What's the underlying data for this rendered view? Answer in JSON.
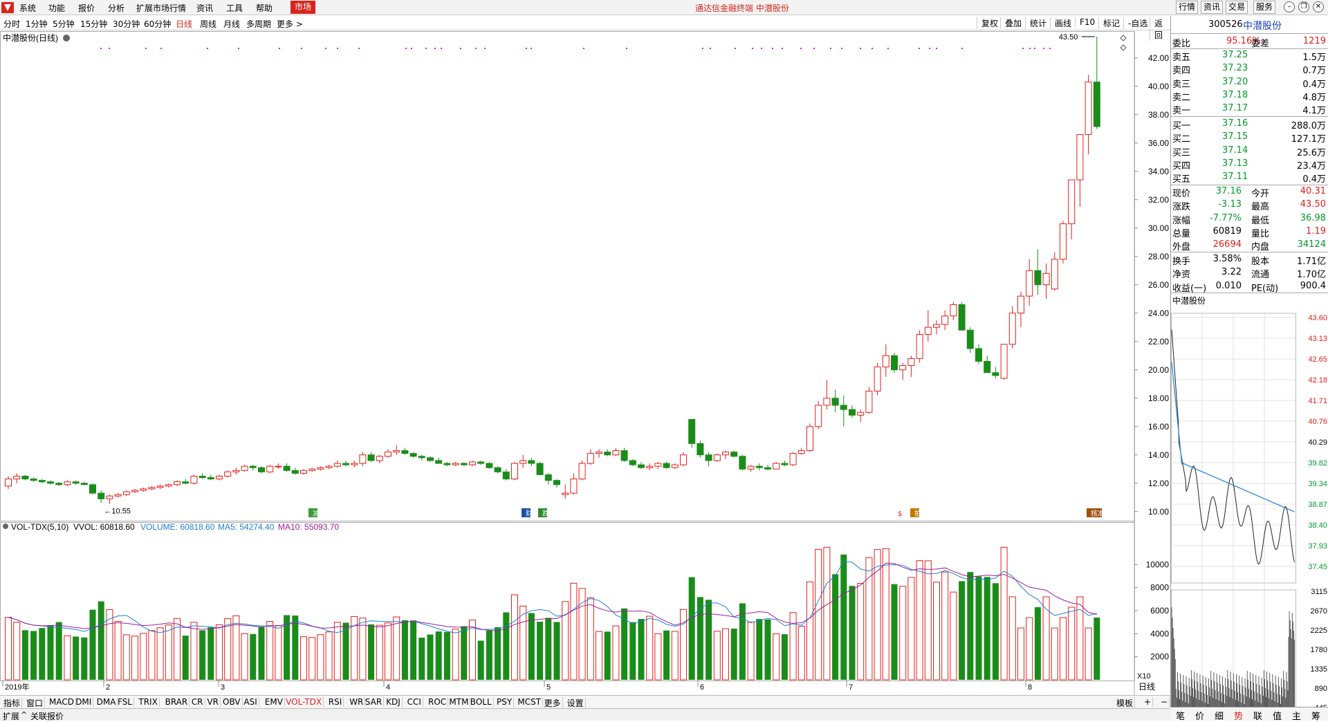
{
  "menu": {
    "items": [
      "系统",
      "功能",
      "报价",
      "分析",
      "扩展市场行情",
      "资讯",
      "工具",
      "帮助"
    ],
    "active": "市场",
    "title": "通达信金融终端  中潜股份",
    "right_buttons": [
      "行情",
      "资讯",
      "交易",
      "服务"
    ]
  },
  "periodbar": {
    "periods": [
      "分时",
      "1分钟",
      "5分钟",
      "15分钟",
      "30分钟",
      "60分钟",
      "日线",
      "周线",
      "月线",
      "多周期",
      "更多 >"
    ],
    "selected": "日线",
    "tools": [
      "复权",
      "叠加",
      "统计",
      "画线",
      "F10",
      "标记",
      "-自选",
      "返回"
    ]
  },
  "chart": {
    "title": "中潜股份(日线)",
    "high_label": "43.50",
    "low_label": "10.55",
    "price_ticks": [
      "42.00",
      "40.00",
      "38.00",
      "36.00",
      "34.00",
      "32.00",
      "30.00",
      "28.00",
      "26.00",
      "24.00",
      "22.00",
      "20.00",
      "18.00",
      "16.00",
      "14.00",
      "12.00",
      "10.00"
    ],
    "markers": [
      "减",
      "财",
      "跌",
      "$",
      "拍",
      "核准"
    ],
    "vol_legend": {
      "name": "VOL-TDX(5,10)",
      "vvol": "VVOL: 60818.60",
      "volume": "VOLUME: 60818.60",
      "ma5": "MA5: 54274.40",
      "ma10": "MA10: 55093.70"
    },
    "vol_ticks": [
      "10000",
      "8000",
      "6000",
      "4000",
      "2000"
    ],
    "vol_unit": "X10",
    "date_labels": [
      "2019年",
      "2",
      "3",
      "4",
      "5",
      "6",
      "7",
      "8"
    ],
    "colors": {
      "up": "#e0201b",
      "down": "#1a8c1a",
      "ma5": "#1e7fd6",
      "ma10": "#9b1f9b"
    }
  },
  "chart_data": {
    "type": "candlestick",
    "title": "中潜股份(日线)",
    "ylim": [
      9.5,
      43.5
    ],
    "candles": [
      [
        11.8,
        12.5,
        11.6,
        12.3
      ],
      [
        12.3,
        12.7,
        12.0,
        12.5
      ],
      [
        12.5,
        12.6,
        12.2,
        12.3
      ],
      [
        12.3,
        12.4,
        12.1,
        12.2
      ],
      [
        12.2,
        12.3,
        12.0,
        12.1
      ],
      [
        12.1,
        12.2,
        11.9,
        12.0
      ],
      [
        12.0,
        12.1,
        11.8,
        11.9
      ],
      [
        11.9,
        12.2,
        11.8,
        12.1
      ],
      [
        12.1,
        12.2,
        11.9,
        12.0
      ],
      [
        12.0,
        12.1,
        11.9,
        11.9
      ],
      [
        11.9,
        12.0,
        11.2,
        11.3
      ],
      [
        11.3,
        11.5,
        10.6,
        10.9
      ],
      [
        10.9,
        11.2,
        10.55,
        11.1
      ],
      [
        11.1,
        11.3,
        11.0,
        11.2
      ],
      [
        11.2,
        11.5,
        11.1,
        11.4
      ],
      [
        11.4,
        11.6,
        11.3,
        11.5
      ],
      [
        11.5,
        11.7,
        11.4,
        11.6
      ],
      [
        11.6,
        11.8,
        11.5,
        11.7
      ],
      [
        11.7,
        11.9,
        11.6,
        11.8
      ],
      [
        11.8,
        12.0,
        11.7,
        11.9
      ],
      [
        11.9,
        12.2,
        11.8,
        12.1
      ],
      [
        12.1,
        12.3,
        11.9,
        12.0
      ],
      [
        12.0,
        12.6,
        11.9,
        12.5
      ],
      [
        12.5,
        12.7,
        12.3,
        12.4
      ],
      [
        12.4,
        12.6,
        12.2,
        12.3
      ],
      [
        12.3,
        12.6,
        12.2,
        12.5
      ],
      [
        12.5,
        12.9,
        12.4,
        12.8
      ],
      [
        12.8,
        13.1,
        12.6,
        12.9
      ],
      [
        12.9,
        13.3,
        12.8,
        13.2
      ],
      [
        13.2,
        13.3,
        12.9,
        13.1
      ],
      [
        13.1,
        13.2,
        12.7,
        12.8
      ],
      [
        12.8,
        13.3,
        12.7,
        13.2
      ],
      [
        13.2,
        13.4,
        13.0,
        13.2
      ],
      [
        13.2,
        13.4,
        12.8,
        12.9
      ],
      [
        12.9,
        13.1,
        12.6,
        12.7
      ],
      [
        12.7,
        13.0,
        12.6,
        12.9
      ],
      [
        12.9,
        13.1,
        12.8,
        13.0
      ],
      [
        13.0,
        13.2,
        12.9,
        13.1
      ],
      [
        13.1,
        13.3,
        13.0,
        13.2
      ],
      [
        13.2,
        13.6,
        13.1,
        13.4
      ],
      [
        13.4,
        13.6,
        13.2,
        13.3
      ],
      [
        13.3,
        13.6,
        13.1,
        13.4
      ],
      [
        13.4,
        14.2,
        13.2,
        14.0
      ],
      [
        14.0,
        14.2,
        13.5,
        13.6
      ],
      [
        13.6,
        14.0,
        13.4,
        13.9
      ],
      [
        13.9,
        14.4,
        13.8,
        14.2
      ],
      [
        14.2,
        14.7,
        14.0,
        14.3
      ],
      [
        14.3,
        14.5,
        14.0,
        14.1
      ],
      [
        14.1,
        14.2,
        13.8,
        13.9
      ],
      [
        13.9,
        14.0,
        13.6,
        13.8
      ],
      [
        13.8,
        13.9,
        13.5,
        13.6
      ],
      [
        13.6,
        13.8,
        13.4,
        13.4
      ],
      [
        13.4,
        13.5,
        13.2,
        13.3
      ],
      [
        13.3,
        13.5,
        13.2,
        13.4
      ],
      [
        13.4,
        13.5,
        13.2,
        13.3
      ],
      [
        13.3,
        13.6,
        13.2,
        13.5
      ],
      [
        13.5,
        13.6,
        13.3,
        13.4
      ],
      [
        13.4,
        13.5,
        13.0,
        13.1
      ],
      [
        13.1,
        13.2,
        12.7,
        12.8
      ],
      [
        12.8,
        13.0,
        12.2,
        12.3
      ],
      [
        12.3,
        13.5,
        12.2,
        13.4
      ],
      [
        13.4,
        14.0,
        13.1,
        13.6
      ],
      [
        13.6,
        13.8,
        13.2,
        13.4
      ],
      [
        13.4,
        13.5,
        12.7,
        12.6
      ],
      [
        12.6,
        12.7,
        11.9,
        12.2
      ],
      [
        12.2,
        12.3,
        11.7,
        11.9
      ],
      [
        11.2,
        11.9,
        10.9,
        11.3
      ],
      [
        11.3,
        12.7,
        11.2,
        12.3
      ],
      [
        12.3,
        13.6,
        12.2,
        13.4
      ],
      [
        13.4,
        14.4,
        13.3,
        14.1
      ],
      [
        14.1,
        14.4,
        13.8,
        14.2
      ],
      [
        14.2,
        14.4,
        13.9,
        14.0
      ],
      [
        14.0,
        14.5,
        13.9,
        14.3
      ],
      [
        14.3,
        14.5,
        13.5,
        13.6
      ],
      [
        13.6,
        13.7,
        13.2,
        13.3
      ],
      [
        13.3,
        13.5,
        13.0,
        13.1
      ],
      [
        13.1,
        13.4,
        12.9,
        13.2
      ],
      [
        13.2,
        13.5,
        13.0,
        13.4
      ],
      [
        13.4,
        13.5,
        13.0,
        13.1
      ],
      [
        13.1,
        13.4,
        13.0,
        13.3
      ],
      [
        13.3,
        14.2,
        13.2,
        14.0
      ],
      [
        16.5,
        16.5,
        14.5,
        14.8
      ],
      [
        14.8,
        15.0,
        13.8,
        14.0
      ],
      [
        14.0,
        14.2,
        13.2,
        13.6
      ],
      [
        13.6,
        14.1,
        13.5,
        14.0
      ],
      [
        14.0,
        14.3,
        13.7,
        14.2
      ],
      [
        14.2,
        14.3,
        13.8,
        13.9
      ],
      [
        13.9,
        14.0,
        12.9,
        13.0
      ],
      [
        13.0,
        13.3,
        12.8,
        13.2
      ],
      [
        13.2,
        13.4,
        12.9,
        13.1
      ],
      [
        13.1,
        13.3,
        12.9,
        13.0
      ],
      [
        13.0,
        13.5,
        13.0,
        13.4
      ],
      [
        13.4,
        13.6,
        13.2,
        13.3
      ],
      [
        13.3,
        14.2,
        13.2,
        14.1
      ],
      [
        14.1,
        14.5,
        14.0,
        14.3
      ],
      [
        14.3,
        16.2,
        14.2,
        16.0
      ],
      [
        16.0,
        17.8,
        15.8,
        17.5
      ],
      [
        17.5,
        19.3,
        17.2,
        18.0
      ],
      [
        18.0,
        18.6,
        17.0,
        17.5
      ],
      [
        17.5,
        18.2,
        16.0,
        17.2
      ],
      [
        17.2,
        17.5,
        16.6,
        16.8
      ],
      [
        16.8,
        17.2,
        16.3,
        17.0
      ],
      [
        17.0,
        18.8,
        16.9,
        18.5
      ],
      [
        18.5,
        20.5,
        18.2,
        20.2
      ],
      [
        20.2,
        21.8,
        19.5,
        21.0
      ],
      [
        21.0,
        21.2,
        19.8,
        20.0
      ],
      [
        20.0,
        20.5,
        19.3,
        20.3
      ],
      [
        20.3,
        21.0,
        19.5,
        20.8
      ],
      [
        20.8,
        22.8,
        20.5,
        22.5
      ],
      [
        22.5,
        24.2,
        22.0,
        23.0
      ],
      [
        23.0,
        23.5,
        22.5,
        23.2
      ],
      [
        23.2,
        24.2,
        22.8,
        23.8
      ],
      [
        23.8,
        24.8,
        23.5,
        24.6
      ],
      [
        24.6,
        24.8,
        23.2,
        22.8
      ],
      [
        22.8,
        23.0,
        21.2,
        21.5
      ],
      [
        21.5,
        21.8,
        20.4,
        20.6
      ],
      [
        20.6,
        21.0,
        19.8,
        19.8
      ],
      [
        19.8,
        20.2,
        19.4,
        19.6
      ],
      [
        19.4,
        21.8,
        19.3,
        21.8
      ],
      [
        21.8,
        24.5,
        21.5,
        24.0
      ],
      [
        24.0,
        25.5,
        23.0,
        25.2
      ],
      [
        25.2,
        27.8,
        24.5,
        27.0
      ],
      [
        27.0,
        28.5,
        25.3,
        26.0
      ],
      [
        26.0,
        27.5,
        25.0,
        26.8
      ],
      [
        25.7,
        28.3,
        25.6,
        27.8
      ],
      [
        27.8,
        30.5,
        27.5,
        30.3
      ],
      [
        30.3,
        32.2,
        29.2,
        33.4
      ],
      [
        33.4,
        36.5,
        31.5,
        36.6
      ],
      [
        36.6,
        40.8,
        35.2,
        40.3
      ],
      [
        40.3,
        43.5,
        36.98,
        37.16
      ]
    ],
    "volume_pane": {
      "ylim": [
        0,
        12000
      ],
      "unit": "X10",
      "series": [
        "VOLUME",
        "MA5",
        "MA10"
      ]
    }
  },
  "quote": {
    "code": "300526",
    "name": "中潜股份",
    "weibi_label": "委比",
    "weibi": "95.16%",
    "weicha_label": "委差",
    "weicha": "1219",
    "asks": [
      {
        "label": "卖五",
        "price": "37.25",
        "vol": "1.5万"
      },
      {
        "label": "卖四",
        "price": "37.23",
        "vol": "0.7万"
      },
      {
        "label": "卖三",
        "price": "37.20",
        "vol": "0.4万"
      },
      {
        "label": "卖二",
        "price": "37.18",
        "vol": "4.8万"
      },
      {
        "label": "卖一",
        "price": "37.17",
        "vol": "4.1万"
      }
    ],
    "bids": [
      {
        "label": "买一",
        "price": "37.16",
        "vol": "288.0万"
      },
      {
        "label": "买二",
        "price": "37.15",
        "vol": "127.1万"
      },
      {
        "label": "买三",
        "price": "37.14",
        "vol": "25.6万"
      },
      {
        "label": "买四",
        "price": "37.13",
        "vol": "23.4万"
      },
      {
        "label": "买五",
        "price": "37.11",
        "vol": "0.4万"
      }
    ],
    "stats": [
      {
        "l1": "现价",
        "v1": "37.16",
        "c1": "green",
        "l2": "今开",
        "v2": "40.31",
        "c2": "red"
      },
      {
        "l1": "涨跌",
        "v1": "-3.13",
        "c1": "green",
        "l2": "最高",
        "v2": "43.50",
        "c2": "red"
      },
      {
        "l1": "涨幅",
        "v1": "-7.77%",
        "c1": "green",
        "l2": "最低",
        "v2": "36.98",
        "c2": "green"
      },
      {
        "l1": "总量",
        "v1": "60819",
        "c1": "black",
        "l2": "量比",
        "v2": "1.19",
        "c2": "red"
      },
      {
        "l1": "外盘",
        "v1": "26694",
        "c1": "red",
        "l2": "内盘",
        "v2": "34124",
        "c2": "green"
      }
    ],
    "stats2": [
      {
        "l1": "换手",
        "v1": "3.58%",
        "l2": "股本",
        "v2": "1.71亿"
      },
      {
        "l1": "净资",
        "v1": "3.22",
        "l2": "流通",
        "v2": "1.70亿"
      },
      {
        "l1": "收益(一)",
        "v1": "0.010",
        "l2": "PE(动)",
        "v2": "900.4"
      }
    ],
    "mini_title": "中潜股份",
    "mini_price_ticks": [
      "43.60",
      "43.13",
      "42.65",
      "42.18",
      "41.71",
      "40.76",
      "40.29",
      "39.82",
      "39.34",
      "38.87",
      "38.40",
      "37.93",
      "37.45"
    ],
    "mini_vol_ticks": [
      "3115",
      "2670",
      "2225",
      "1780",
      "1335",
      "890",
      "445"
    ]
  },
  "indicators": [
    "指标",
    "窗口",
    "MACD",
    "DMI",
    "DMA",
    "FSL",
    "TRIX",
    "BRAR",
    "CR",
    "VR",
    "OBV",
    "ASI",
    "EMV",
    "VOL-TDX",
    "RSI",
    "WR",
    "SAR",
    "KDJ",
    "CCI",
    "ROC",
    "MTM",
    "BOLL",
    "PSY",
    "MCST",
    "更多",
    "设置"
  ],
  "indicator_selected": "VOL-TDX",
  "template_label": "模板",
  "status": {
    "expand": "扩展",
    "link": "关联报价",
    "period": "日线"
  },
  "rtabs": [
    "笔",
    "价",
    "细",
    "势",
    "联",
    "值",
    "主",
    "筹"
  ],
  "rtab_selected": "势"
}
